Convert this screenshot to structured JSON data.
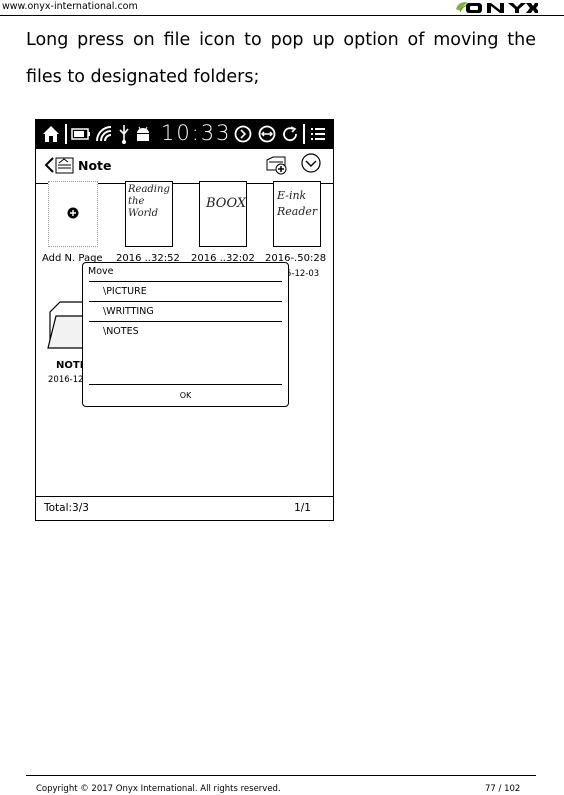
{
  "header": {
    "url": "www.onyx-international.com",
    "logo_text": "ONYX"
  },
  "body": {
    "paragraph": "Long press on file icon to pop up option of moving the files to designated folders;"
  },
  "device": {
    "status_bar": {
      "time": "10:33",
      "icons": [
        "home-icon",
        "battery-icon",
        "wifi-icon",
        "usb-icon",
        "android-icon",
        "rotate-icon",
        "back-forward-icon",
        "refresh-icon",
        "menu-icon"
      ]
    },
    "title_bar": {
      "title": "Note",
      "icons": [
        "back-arrow-icon",
        "note-app-icon",
        "new-folder-icon",
        "dropdown-circle-icon"
      ]
    },
    "notes": [
      {
        "label": "Add N. Page",
        "handwriting": ""
      },
      {
        "label": "2016 ..32:52",
        "handwriting": "Reading the World"
      },
      {
        "label": "2016 ..32:02",
        "handwriting": "BOOX"
      },
      {
        "label": "2016-.50:28",
        "date": "5-12-03",
        "handwriting": "E-ink Reader"
      }
    ],
    "folder": {
      "label": "NOTI",
      "date": "2016-12"
    },
    "move_dialog": {
      "title": "Move",
      "options": [
        "\\PICTURE",
        "\\WRITTING",
        "\\NOTES"
      ],
      "ok_label": "OK"
    },
    "footer": {
      "total": "Total:3/3",
      "page": "1/1"
    }
  },
  "footer": {
    "copyright": "Copyright © 2017 Onyx International. All rights reserved.",
    "page_number": "77 / 102"
  }
}
